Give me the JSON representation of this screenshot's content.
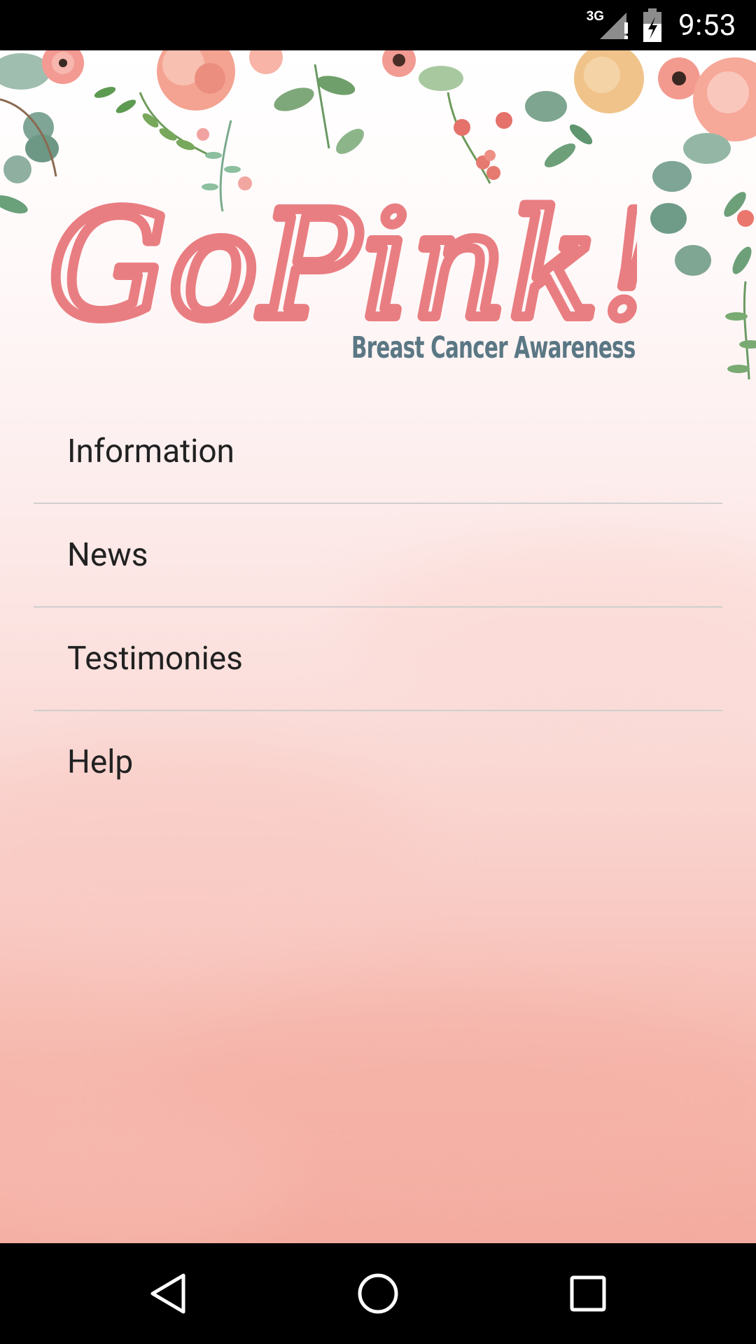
{
  "status_bar": {
    "network_type": "3G",
    "time": "9:53",
    "icons": [
      "signal-icon",
      "alert-icon",
      "battery-charging-icon"
    ]
  },
  "header": {
    "logo_title": "GoPink!",
    "logo_subtitle": "Breast Cancer Awareness"
  },
  "menu": {
    "items": [
      {
        "label": "Information"
      },
      {
        "label": "News"
      },
      {
        "label": "Testimonies"
      },
      {
        "label": "Help"
      }
    ]
  },
  "nav_bar": {
    "icons": [
      "back-icon",
      "home-icon",
      "recents-icon"
    ]
  },
  "colors": {
    "logo_pink": "#e97e82",
    "subtitle_slate": "#5a7784",
    "background_top": "#ffffff",
    "background_bottom": "#f4ab9f",
    "divider": "#d0cece",
    "menu_text": "#212121"
  }
}
